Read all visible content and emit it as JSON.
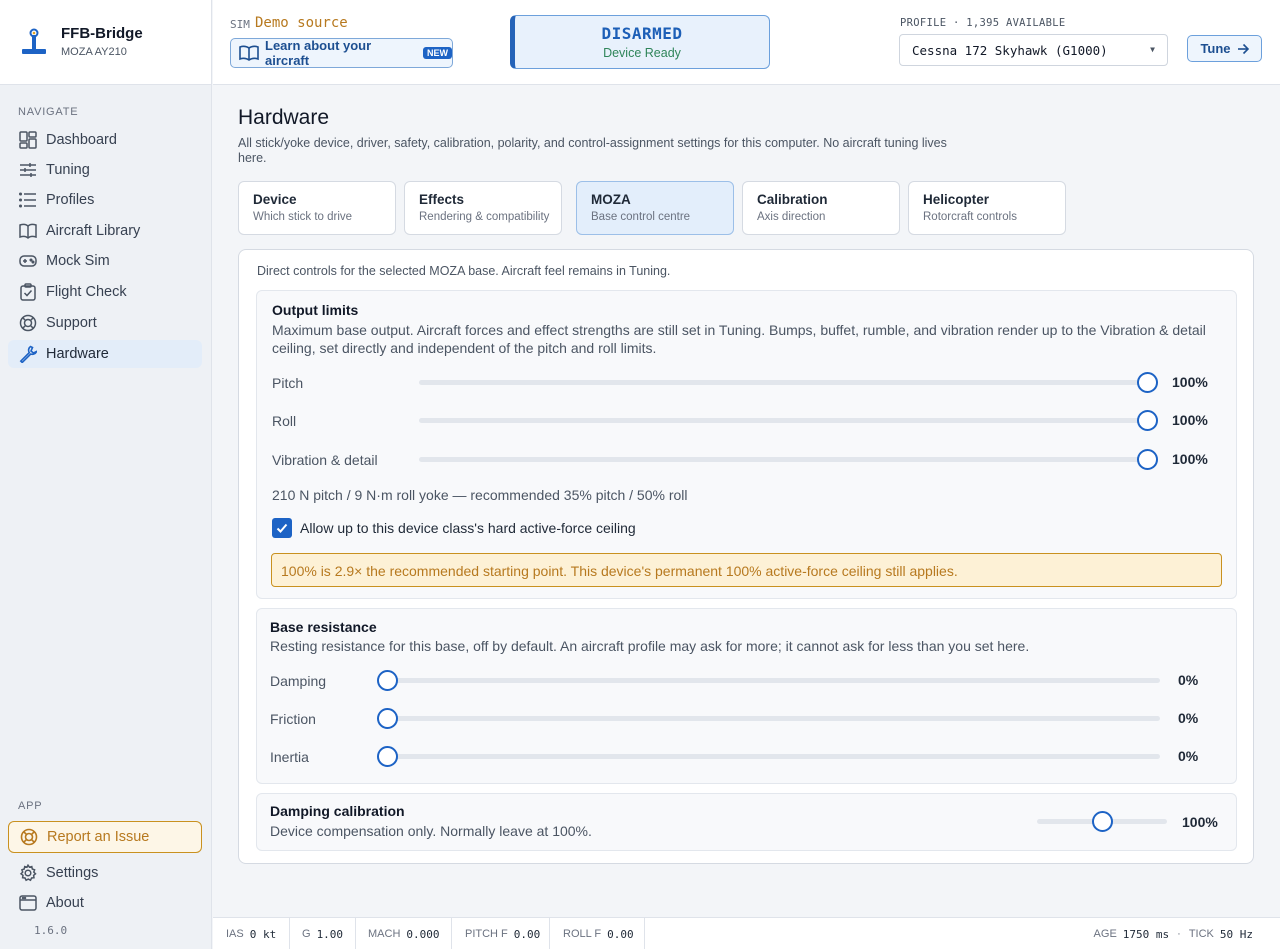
{
  "app": {
    "title": "FFB-Bridge",
    "device": "MOZA AY210",
    "version": "1.6.0"
  },
  "sidebar": {
    "navigate_heading": "NAVIGATE",
    "items": [
      {
        "label": "Dashboard",
        "icon": "dashboard-icon"
      },
      {
        "label": "Tuning",
        "icon": "sliders-icon"
      },
      {
        "label": "Profiles",
        "icon": "list-icon"
      },
      {
        "label": "Aircraft Library",
        "icon": "book-icon"
      },
      {
        "label": "Mock Sim",
        "icon": "gamepad-icon"
      },
      {
        "label": "Flight Check",
        "icon": "clipboard-check-icon"
      },
      {
        "label": "Support",
        "icon": "lifebuoy-icon"
      },
      {
        "label": "Hardware",
        "icon": "wrench-icon"
      }
    ],
    "active": "Hardware",
    "app_heading": "APP",
    "report_label": "Report an Issue",
    "settings_label": "Settings",
    "about_label": "About"
  },
  "topbar": {
    "sim_label": "SIM",
    "sim_value": "Demo source",
    "learn_label": "Learn about your aircraft",
    "new_badge": "NEW",
    "arm_state": "DISARMED",
    "arm_sub": "Device Ready",
    "profile_label": "PROFILE · 1,395 AVAILABLE",
    "profile_value": "Cessna 172 Skyhawk (G1000)",
    "tune_label": "Tune"
  },
  "page": {
    "title": "Hardware",
    "description": "All stick/yoke device, driver, safety, calibration, polarity, and control-assignment settings for this computer. No aircraft tuning lives here."
  },
  "tabs": [
    {
      "title": "Device",
      "subtitle": "Which stick to drive"
    },
    {
      "title": "Effects",
      "subtitle": "Rendering & compatibility"
    },
    {
      "title": "MOZA",
      "subtitle": "Base control centre"
    },
    {
      "title": "Calibration",
      "subtitle": "Axis direction"
    },
    {
      "title": "Helicopter",
      "subtitle": "Rotorcraft controls"
    }
  ],
  "active_tab": "MOZA",
  "panel": {
    "intro": "Direct controls for the selected MOZA base. Aircraft feel remains in Tuning.",
    "output_limits": {
      "title": "Output limits",
      "description": "Maximum base output. Aircraft forces and effect strengths are still set in Tuning. Bumps, buffet, rumble, and vibration render up to the Vibration & detail ceiling, set directly and independent of the pitch and roll limits.",
      "sliders": [
        {
          "label": "Pitch",
          "value": 100,
          "display": "100%"
        },
        {
          "label": "Roll",
          "value": 100,
          "display": "100%"
        },
        {
          "label": "Vibration & detail",
          "value": 100,
          "display": "100%"
        }
      ],
      "device_note": "210 N pitch / 9 N·m roll yoke — recommended 35% pitch / 50% roll",
      "ceiling_checked": true,
      "ceiling_label": "Allow up to this device class's hard active-force ceiling",
      "warning": "100% is 2.9× the recommended starting point. This device's permanent 100% active-force ceiling still applies."
    },
    "base_resistance": {
      "title": "Base resistance",
      "description": "Resting resistance for this base, off by default. An aircraft profile may ask for more; it cannot ask for less than you set here.",
      "sliders": [
        {
          "label": "Damping",
          "value": 0,
          "display": "0%"
        },
        {
          "label": "Friction",
          "value": 0,
          "display": "0%"
        },
        {
          "label": "Inertia",
          "value": 0,
          "display": "0%"
        }
      ]
    },
    "damping_calibration": {
      "title": "Damping calibration",
      "description": "Device compensation only. Normally leave at 100%.",
      "value": 100,
      "max": 200,
      "display": "100%"
    }
  },
  "statusbar": {
    "items": [
      {
        "label": "IAS",
        "value": "0 kt"
      },
      {
        "label": "G",
        "value": "1.00"
      },
      {
        "label": "MACH",
        "value": "0.000"
      },
      {
        "label": "PITCH F",
        "value": "0.00"
      },
      {
        "label": "ROLL F",
        "value": "0.00"
      }
    ],
    "age_label": "AGE",
    "age_value": "1750 ms",
    "separator": "·",
    "tick_label": "TICK",
    "tick_value": "50 Hz"
  },
  "colors": {
    "accent": "#1d63c5",
    "warning": "#b7791f",
    "ready": "#2f855a"
  }
}
